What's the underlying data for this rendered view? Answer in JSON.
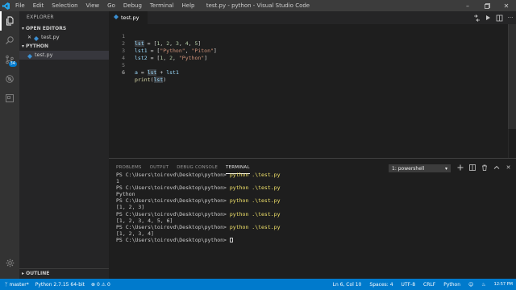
{
  "window": {
    "title": "test.py - python - Visual Studio Code",
    "menu": [
      "File",
      "Edit",
      "Selection",
      "View",
      "Go",
      "Debug",
      "Terminal",
      "Help"
    ],
    "controls": [
      "minimize-icon",
      "restore-icon",
      "close-icon"
    ]
  },
  "activity_bar": {
    "items": [
      "files-icon",
      "search-icon",
      "source-control-icon",
      "debug-icon",
      "extensions-icon"
    ],
    "scm_badge": "34",
    "bottom": "gear-icon"
  },
  "sidebar": {
    "header": "EXPLORER",
    "open_editors_label": "OPEN EDITORS",
    "open_editors": [
      {
        "name": "test.py"
      }
    ],
    "folder_label": "PYTHON",
    "files": [
      {
        "name": "test.py"
      }
    ],
    "outline_label": "OUTLINE"
  },
  "editor": {
    "tab_label": "test.py",
    "actions": [
      "compare-icon",
      "run-icon",
      "split-editor-icon",
      "more-icon"
    ],
    "line_numbers": [
      "1",
      "2",
      "3",
      "4",
      "5",
      "6"
    ],
    "lines": [
      "lst = [1, 2, 3, 4, 5]",
      "lst1 = [\"Python\", \"Piton\"]",
      "lst2 = [1, 2, \"Python\"]",
      "",
      "a = lst + lst1",
      "print(lst)"
    ]
  },
  "panel": {
    "tabs": [
      "PROBLEMS",
      "OUTPUT",
      "DEBUG CONSOLE",
      "TERMINAL"
    ],
    "active_tab": "TERMINAL",
    "shell_selector": "1: powershell",
    "actions": [
      "add-terminal-icon",
      "split-terminal-icon",
      "trash-icon",
      "maximize-panel-icon",
      "close-panel-icon"
    ],
    "terminal_prompt": "PS C:\\Users\\toirovd\\Desktop\\python>",
    "terminal_command": "python .\\test.py",
    "terminal_outputs": [
      "1",
      "Python",
      "[1, 2, 3]",
      "[1, 2, 3, 4, 5, 6]",
      "[1, 2, 3, 4]"
    ]
  },
  "status_bar": {
    "branch": "master*",
    "interpreter": "Python 2.7.15 64-bit",
    "errors": "0",
    "warnings": "0",
    "position": "Ln 6, Col 10",
    "spaces": "Spaces: 4",
    "encoding": "UTF-8",
    "eol": "CRLF",
    "language": "Python",
    "clock": "12:57 PM"
  },
  "colors": {
    "accent": "#007acc",
    "keyword_var": "#9cdcfe",
    "string": "#ce9178",
    "number": "#b5cea8",
    "function": "#dcdcaa",
    "terminal_command": "#f2e36a"
  }
}
